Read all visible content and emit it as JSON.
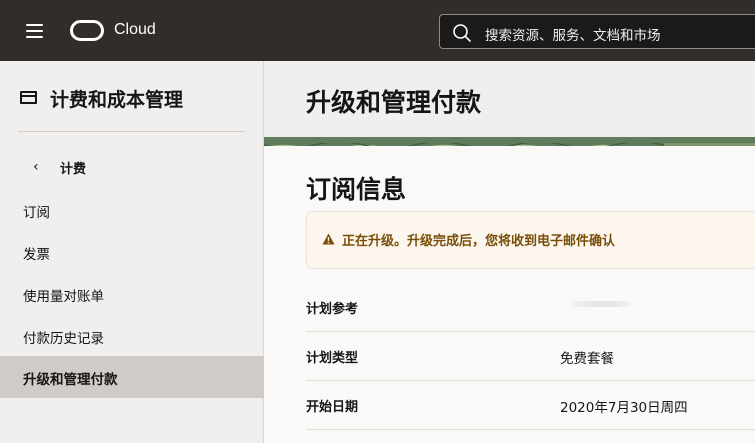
{
  "topbar": {
    "brand": "Cloud",
    "search_placeholder": "搜索资源、服务、文档和市场"
  },
  "sidebar": {
    "title": "计费和成本管理",
    "back_label": "计费",
    "items": [
      {
        "label": "订阅",
        "active": false
      },
      {
        "label": "发票",
        "active": false
      },
      {
        "label": "使用量对账单",
        "active": false
      },
      {
        "label": "付款历史记录",
        "active": false
      },
      {
        "label": "升级和管理付款",
        "active": true
      }
    ]
  },
  "main": {
    "page_title": "升级和管理付款",
    "section_title": "订阅信息",
    "alert": {
      "message": "正在升级。升级完成后，您将收到电子邮件确认",
      "color": "#7a4e08"
    },
    "rows": [
      {
        "label": "计划参考",
        "value": ""
      },
      {
        "label": "计划类型",
        "value": "免费套餐"
      },
      {
        "label": "开始日期",
        "value": "2020年7月30日周四"
      }
    ]
  },
  "colors": {
    "topbar_bg": "#312d2a",
    "active_item_bg": "#cfccc8",
    "banner_green": "#5f7d5c"
  }
}
